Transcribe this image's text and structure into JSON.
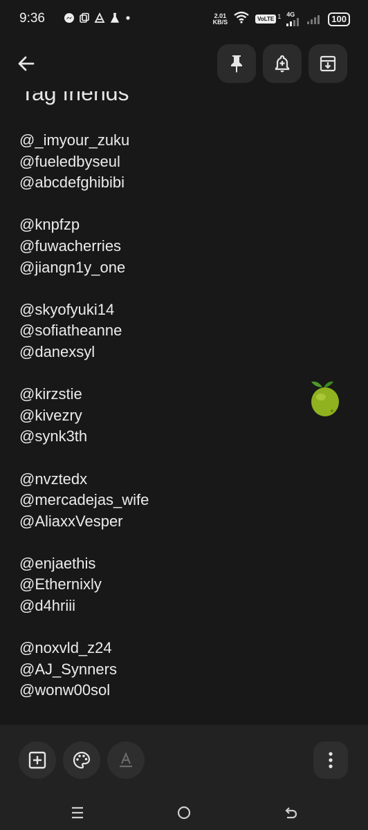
{
  "status": {
    "time": "9:36",
    "net_speed_value": "2.01",
    "net_speed_unit": "KB/S",
    "volte": "VoLTE",
    "sim1": "1",
    "network": "4G",
    "battery": "100"
  },
  "toolbar": {
    "back_icon": "arrow-left-icon",
    "pin_icon": "pin-icon",
    "reminder_icon": "bell-plus-icon",
    "archive_icon": "archive-icon"
  },
  "note": {
    "title": "Tag friends",
    "groups": [
      [
        "@_imyour_zuku",
        "@fueledbyseul",
        "@abcdefghibibi"
      ],
      [
        "@knpfzp",
        "@fuwacherries",
        "@jiangn1y_one"
      ],
      [
        "@skyofyuki14",
        "@sofiatheanne",
        "@danexsyl"
      ],
      [
        "@kirzstie",
        "@kivezry",
        "@synk3th"
      ],
      [
        "@nvztedx",
        "@mercadejas_wife",
        "@AliaxxVesper"
      ],
      [
        "@enjaethis",
        "@Ethernixly",
        "@d4hriii"
      ],
      [
        "@noxvld_z24",
        "@AJ_Synners",
        "@wonw00sol"
      ]
    ],
    "sticker": "lime-sticker"
  },
  "bottom": {
    "add_icon": "add-box-icon",
    "palette_icon": "palette-icon",
    "text_format_icon": "text-format-icon",
    "more_icon": "more-vert-icon"
  },
  "colors": {
    "background": "#181818",
    "bar": "#222222",
    "button": "#2b2b2b",
    "text": "#ececec"
  }
}
